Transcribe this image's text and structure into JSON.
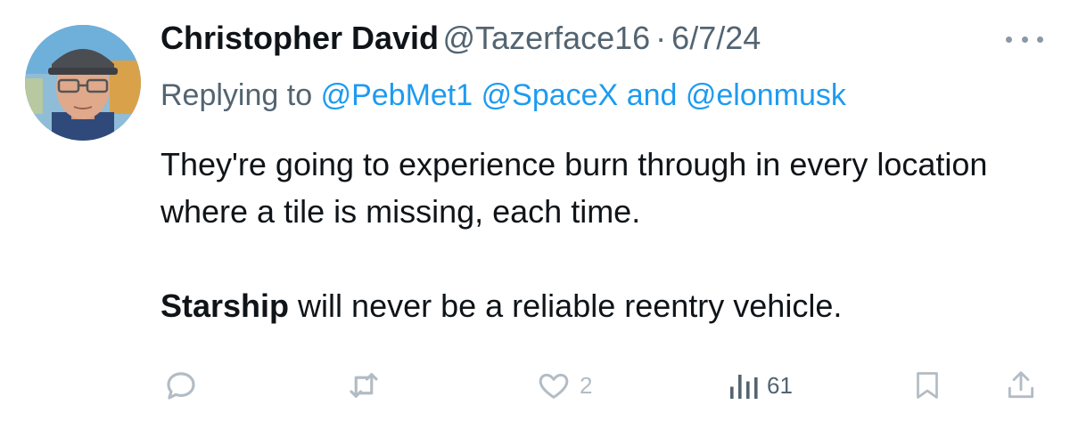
{
  "author": {
    "display_name": "Christopher David",
    "handle": "@Tazerface16",
    "separator": "·",
    "date": "6/7/24"
  },
  "reply": {
    "prefix": "Replying to",
    "mentions": [
      "@PebMet1",
      "@SpaceX"
    ],
    "joiner": "and",
    "last_mention": "@elonmusk"
  },
  "body": {
    "line1": "They're going to experience burn through in every location where a tile is missing, each time.",
    "line2_bold": "Starship",
    "line2_rest": " will never be a reliable reentry vehicle."
  },
  "actions": {
    "reply_icon": "reply-icon",
    "retweet_icon": "retweet-icon",
    "like_icon": "heart-icon",
    "like_count": "2",
    "views_icon": "views-icon",
    "views_count": "61",
    "bookmark_icon": "bookmark-icon",
    "share_icon": "share-icon"
  },
  "colors": {
    "text": "#0f1419",
    "secondary": "#536471",
    "link": "#1d9bf0",
    "action_icon": "#b3bcc4"
  }
}
